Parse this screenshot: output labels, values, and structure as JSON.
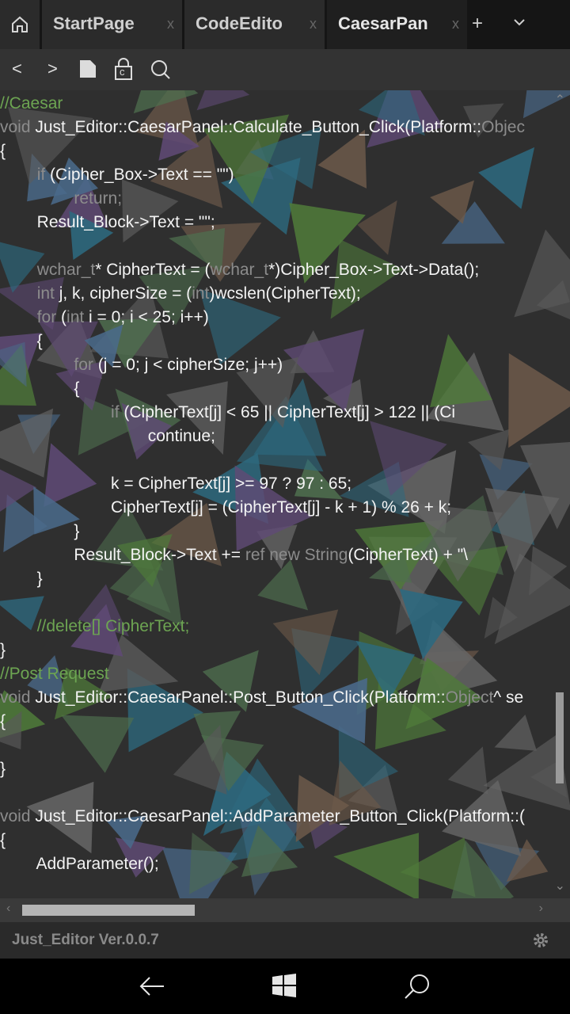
{
  "tabs": [
    {
      "label": "StartPage",
      "close": "x"
    },
    {
      "label": "CodeEdito",
      "close": "x"
    },
    {
      "label": "CaesarPan",
      "close": "x"
    }
  ],
  "new_tab_label": "+",
  "toolbar": {
    "back": "<",
    "forward": ">",
    "cipher_badge": "c"
  },
  "code_lines": [
    [
      [
        "//Caesar",
        "cm"
      ]
    ],
    [
      [
        "void ",
        "kw"
      ],
      [
        "Just_Editor::CaesarPanel::Calculate_Button_Click(Platform::",
        ""
      ],
      [
        "Objec",
        "kw"
      ]
    ],
    [
      [
        "{",
        ""
      ]
    ],
    [
      [
        "        ",
        ""
      ],
      [
        "if ",
        "kw"
      ],
      [
        "(Cipher_Box->Text == \"\")",
        ""
      ]
    ],
    [
      [
        "                ",
        ""
      ],
      [
        "return;",
        "kw"
      ]
    ],
    [
      [
        "        Result_Block->Text = \"\";",
        ""
      ]
    ],
    [
      [
        "",
        ""
      ]
    ],
    [
      [
        "        ",
        ""
      ],
      [
        "wchar_t",
        "kw"
      ],
      [
        "* CipherText = (",
        ""
      ],
      [
        "wchar_t",
        "kw"
      ],
      [
        "*)Cipher_Box->Text->Data();",
        ""
      ]
    ],
    [
      [
        "        ",
        ""
      ],
      [
        "int ",
        "kw"
      ],
      [
        "j, k, cipherSize = (",
        ""
      ],
      [
        "int",
        "kw"
      ],
      [
        ")wcslen(CipherText);",
        ""
      ]
    ],
    [
      [
        "        ",
        ""
      ],
      [
        "for ",
        "kw"
      ],
      [
        "(",
        ""
      ],
      [
        "int ",
        "kw"
      ],
      [
        "i = 0; i < 25; i++)",
        ""
      ]
    ],
    [
      [
        "        {",
        ""
      ]
    ],
    [
      [
        "                ",
        ""
      ],
      [
        "for ",
        "kw"
      ],
      [
        "(j = 0; j < cipherSize; j++)",
        ""
      ]
    ],
    [
      [
        "                {",
        ""
      ]
    ],
    [
      [
        "                        ",
        ""
      ],
      [
        "if ",
        "kw"
      ],
      [
        "(CipherText[j] < 65 || CipherText[j] > 122 || (Ci",
        ""
      ]
    ],
    [
      [
        "                                continue;",
        ""
      ]
    ],
    [
      [
        "",
        ""
      ]
    ],
    [
      [
        "                        k = CipherText[j] >= 97 ? 97 : 65;",
        ""
      ]
    ],
    [
      [
        "                        CipherText[j] = (CipherText[j] - k + 1) % 26 + k;",
        ""
      ]
    ],
    [
      [
        "                }",
        ""
      ]
    ],
    [
      [
        "                Result_Block->Text += ",
        ""
      ],
      [
        "ref new String",
        "kw"
      ],
      [
        "(CipherText) + \"\\",
        ""
      ]
    ],
    [
      [
        "        }",
        ""
      ]
    ],
    [
      [
        "",
        ""
      ]
    ],
    [
      [
        "        ",
        ""
      ],
      [
        "//delete[] CipherText;",
        "cm"
      ]
    ],
    [
      [
        "}",
        ""
      ]
    ],
    [
      [
        "//Post Request",
        "cm"
      ]
    ],
    [
      [
        "void ",
        "kw"
      ],
      [
        "Just_Editor::CaesarPanel::Post_Button_Click(Platform::",
        ""
      ],
      [
        "Object",
        "kw"
      ],
      [
        "^ se",
        ""
      ]
    ],
    [
      [
        "{",
        ""
      ]
    ],
    [
      [
        "",
        ""
      ]
    ],
    [
      [
        "}",
        ""
      ]
    ],
    [
      [
        "",
        ""
      ]
    ],
    [
      [
        "void ",
        "kw"
      ],
      [
        "Just_Editor::CaesarPanel::AddParameter_Button_Click(Platform::(",
        ""
      ]
    ],
    [
      [
        "{",
        ""
      ]
    ],
    [
      [
        "        AddParameter();",
        ""
      ]
    ]
  ],
  "status": {
    "version": "Just_Editor Ver.0.0.7"
  }
}
